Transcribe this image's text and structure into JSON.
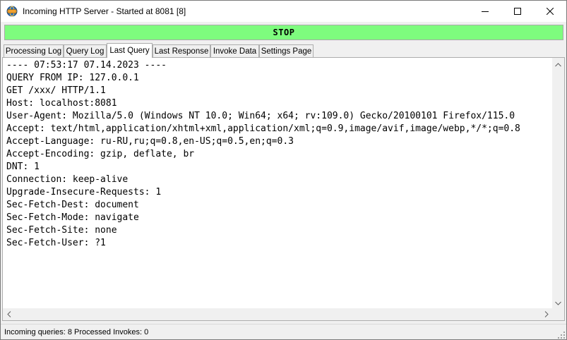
{
  "window": {
    "title": "Incoming HTTP Server - Started at 8081 [8]"
  },
  "titlebar_buttons": [
    {
      "name": "minimize",
      "icon": "minimize-icon"
    },
    {
      "name": "maximize",
      "icon": "maximize-icon"
    },
    {
      "name": "close",
      "icon": "close-icon"
    }
  ],
  "stop_button": {
    "label": "STOP",
    "color": "#7efc7e"
  },
  "tabs": [
    {
      "label": "Processing Log",
      "active": false
    },
    {
      "label": "Query Log",
      "active": false
    },
    {
      "label": "Last Query",
      "active": true
    },
    {
      "label": "Last Response",
      "active": false
    },
    {
      "label": "Invoke Data",
      "active": false
    },
    {
      "label": "Settings Page",
      "active": false
    }
  ],
  "last_query": {
    "lines": [
      "---- 07:53:17 07.14.2023 ----",
      "QUERY FROM IP: 127.0.0.1",
      "GET /xxx/ HTTP/1.1",
      "Host: localhost:8081",
      "User-Agent: Mozilla/5.0 (Windows NT 10.0; Win64; x64; rv:109.0) Gecko/20100101 Firefox/115.0",
      "Accept: text/html,application/xhtml+xml,application/xml;q=0.9,image/avif,image/webp,*/*;q=0.8",
      "Accept-Language: ru-RU,ru;q=0.8,en-US;q=0.5,en;q=0.3",
      "Accept-Encoding: gzip, deflate, br",
      "DNT: 1",
      "Connection: keep-alive",
      "Upgrade-Insecure-Requests: 1",
      "Sec-Fetch-Dest: document",
      "Sec-Fetch-Mode: navigate",
      "Sec-Fetch-Site: none",
      "Sec-Fetch-User: ?1"
    ]
  },
  "status_bar": {
    "text": "Incoming queries: 8  Processed Invokes: 0"
  }
}
